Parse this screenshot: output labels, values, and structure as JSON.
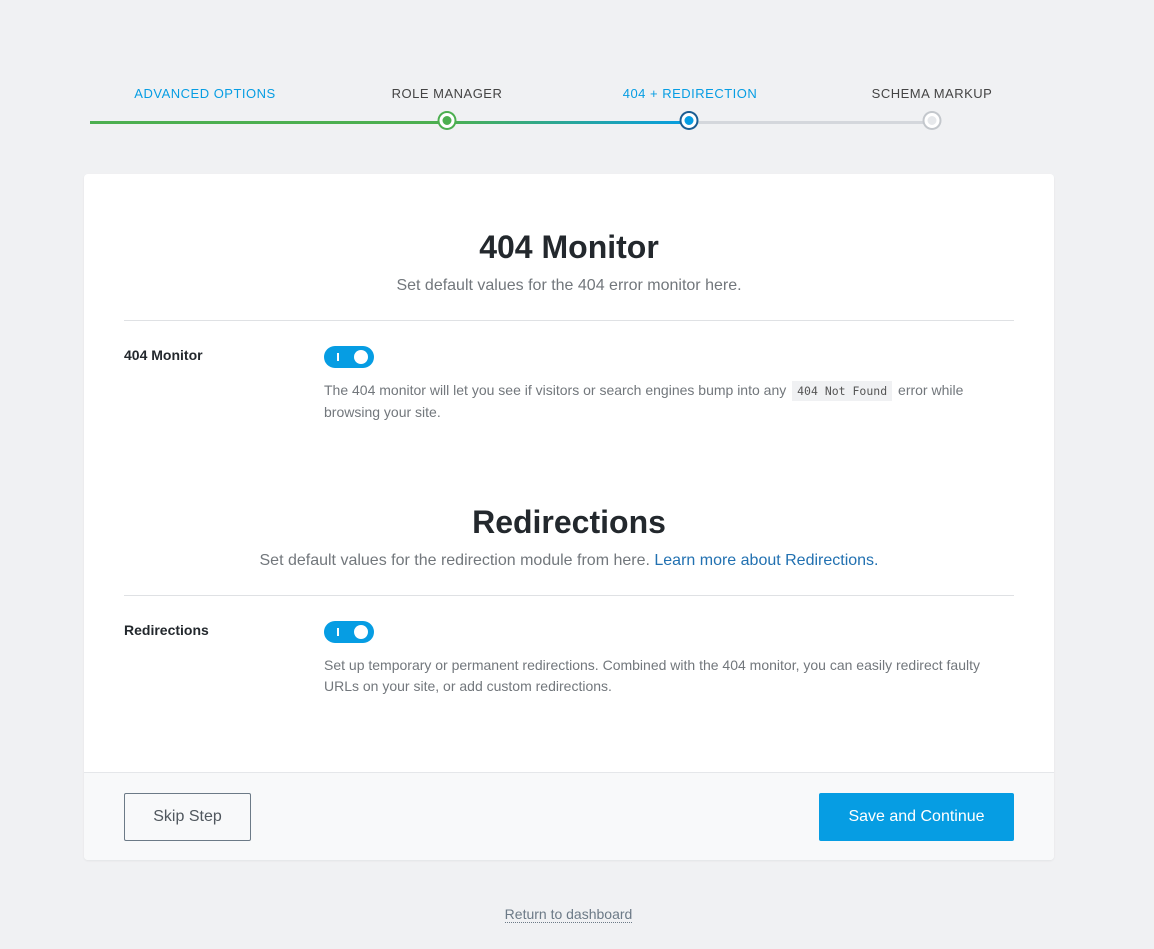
{
  "steps": [
    {
      "label": "Advanced Options",
      "state": "done"
    },
    {
      "label": "Role Manager",
      "state": "done"
    },
    {
      "label": "404 + Redirection",
      "state": "current"
    },
    {
      "label": "Schema Markup",
      "state": "todo"
    }
  ],
  "monitor_section": {
    "title": "404 Monitor",
    "description": "Set default values for the 404 error monitor here.",
    "field_label": "404 Monitor",
    "toggle_on": true,
    "help_before": "The 404 monitor will let you see if visitors or search engines bump into any ",
    "help_code": "404 Not Found",
    "help_after": " error while browsing your site."
  },
  "redirections_section": {
    "title": "Redirections",
    "description": "Set default values for the redirection module from here. ",
    "learn_more": "Learn more about Redirections.",
    "field_label": "Redirections",
    "toggle_on": true,
    "help": "Set up temporary or permanent redirections. Combined with the 404 monitor, you can easily redirect faulty URLs on your site, or add custom redirections."
  },
  "footer": {
    "skip_label": "Skip Step",
    "save_label": "Save and Continue"
  },
  "return_link": "Return to dashboard",
  "colors": {
    "accent": "#069de3",
    "done": "#4caf50",
    "todo": "#c3c7cc",
    "background": "#f0f1f3"
  }
}
